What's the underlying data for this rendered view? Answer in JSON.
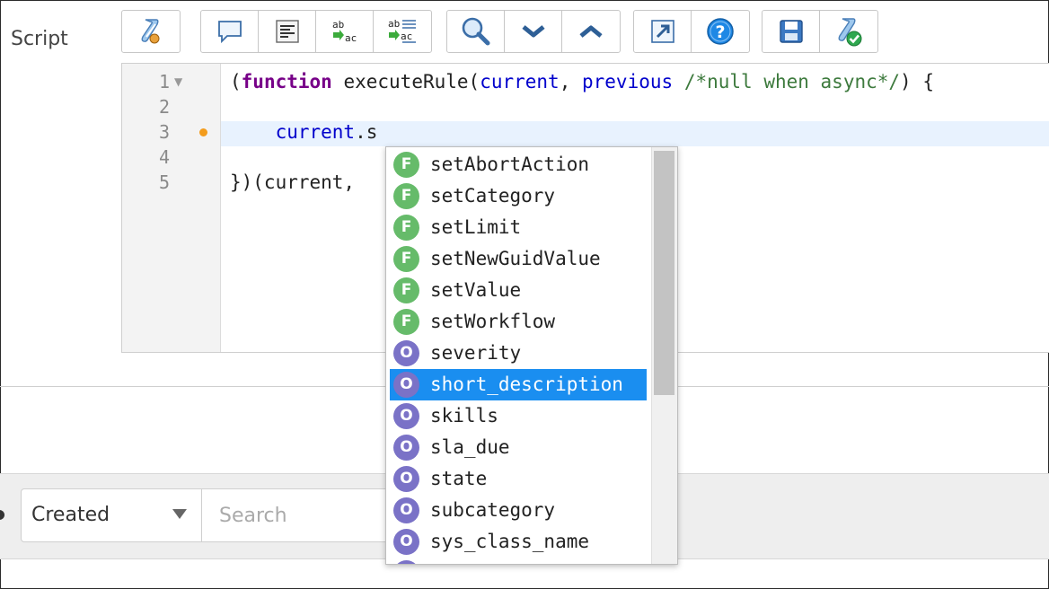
{
  "field_label": "Script",
  "toolbar": {
    "groups": [
      [
        {
          "icon": "script-include-icon"
        }
      ],
      [
        {
          "icon": "comment-icon"
        },
        {
          "icon": "format-code-icon"
        },
        {
          "icon": "replace-icon"
        },
        {
          "icon": "replace-all-icon"
        }
      ],
      [
        {
          "icon": "search-icon"
        },
        {
          "icon": "find-next-icon"
        },
        {
          "icon": "find-previous-icon"
        }
      ],
      [
        {
          "icon": "fullscreen-icon"
        },
        {
          "icon": "help-icon"
        }
      ],
      [
        {
          "icon": "save-icon"
        },
        {
          "icon": "syntax-check-icon"
        }
      ]
    ]
  },
  "editor": {
    "line_numbers": [
      "1",
      "2",
      "3",
      "4",
      "5"
    ],
    "lines": [
      {
        "tokens": [
          [
            "",
            "("
          ],
          [
            "kw",
            "function"
          ],
          [
            "",
            " executeRule("
          ],
          [
            "var",
            "current"
          ],
          [
            "",
            ", "
          ],
          [
            "var",
            "previous"
          ],
          [
            "",
            " "
          ],
          [
            "cm",
            "/*null when async*/"
          ],
          [
            "",
            ") {"
          ]
        ]
      },
      {
        "tokens": []
      },
      {
        "tokens": [
          [
            "",
            "    "
          ],
          [
            "var",
            "current"
          ],
          [
            "",
            ".s"
          ]
        ]
      },
      {
        "tokens": []
      },
      {
        "tokens": [
          [
            "",
            "})(current, "
          ]
        ]
      }
    ]
  },
  "autocomplete": {
    "selected_index": 7,
    "items": [
      {
        "kind": "F",
        "label": "setAbortAction"
      },
      {
        "kind": "F",
        "label": "setCategory"
      },
      {
        "kind": "F",
        "label": "setLimit"
      },
      {
        "kind": "F",
        "label": "setNewGuidValue"
      },
      {
        "kind": "F",
        "label": "setValue"
      },
      {
        "kind": "F",
        "label": "setWorkflow"
      },
      {
        "kind": "O",
        "label": "severity"
      },
      {
        "kind": "O",
        "label": "short_description"
      },
      {
        "kind": "O",
        "label": "skills"
      },
      {
        "kind": "O",
        "label": "sla_due"
      },
      {
        "kind": "O",
        "label": "state"
      },
      {
        "kind": "O",
        "label": "subcategory"
      },
      {
        "kind": "O",
        "label": "sys_class_name"
      }
    ]
  },
  "filter": {
    "field_value": "Created",
    "search_placeholder": "Search"
  },
  "colors": {
    "selection": "#1a8ef0",
    "function_badge": "#66bb6a",
    "property_badge": "#7a72c7",
    "keyword": "#770088",
    "variable": "#0000cc",
    "comment": "#3d7a3d"
  }
}
